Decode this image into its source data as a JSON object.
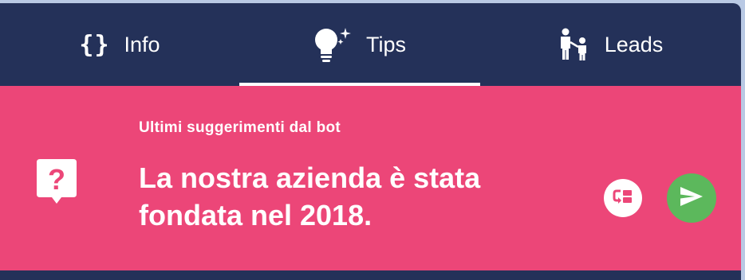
{
  "colors": {
    "header_bg": "#243159",
    "banner_bg": "#ec4678",
    "send_button": "#5cb85c",
    "text": "#ffffff"
  },
  "tabs": [
    {
      "label": "Info",
      "icon": "code-braces-icon",
      "active": false
    },
    {
      "label": "Tips",
      "icon": "lightbulb-sparkle-icon",
      "active": true
    },
    {
      "label": "Leads",
      "icon": "person-child-icon",
      "active": false
    }
  ],
  "info_icon_glyph": "{}",
  "banner": {
    "title": "Ultimi suggerimenti dal bot",
    "suggestion": "La nostra azienda è stata fondata nel 2018.",
    "left_icon": "question-bubble-icon",
    "actions": [
      {
        "name": "swap-suggestion",
        "icon": "swap-card-icon"
      },
      {
        "name": "send-suggestion",
        "icon": "send-icon"
      }
    ]
  }
}
